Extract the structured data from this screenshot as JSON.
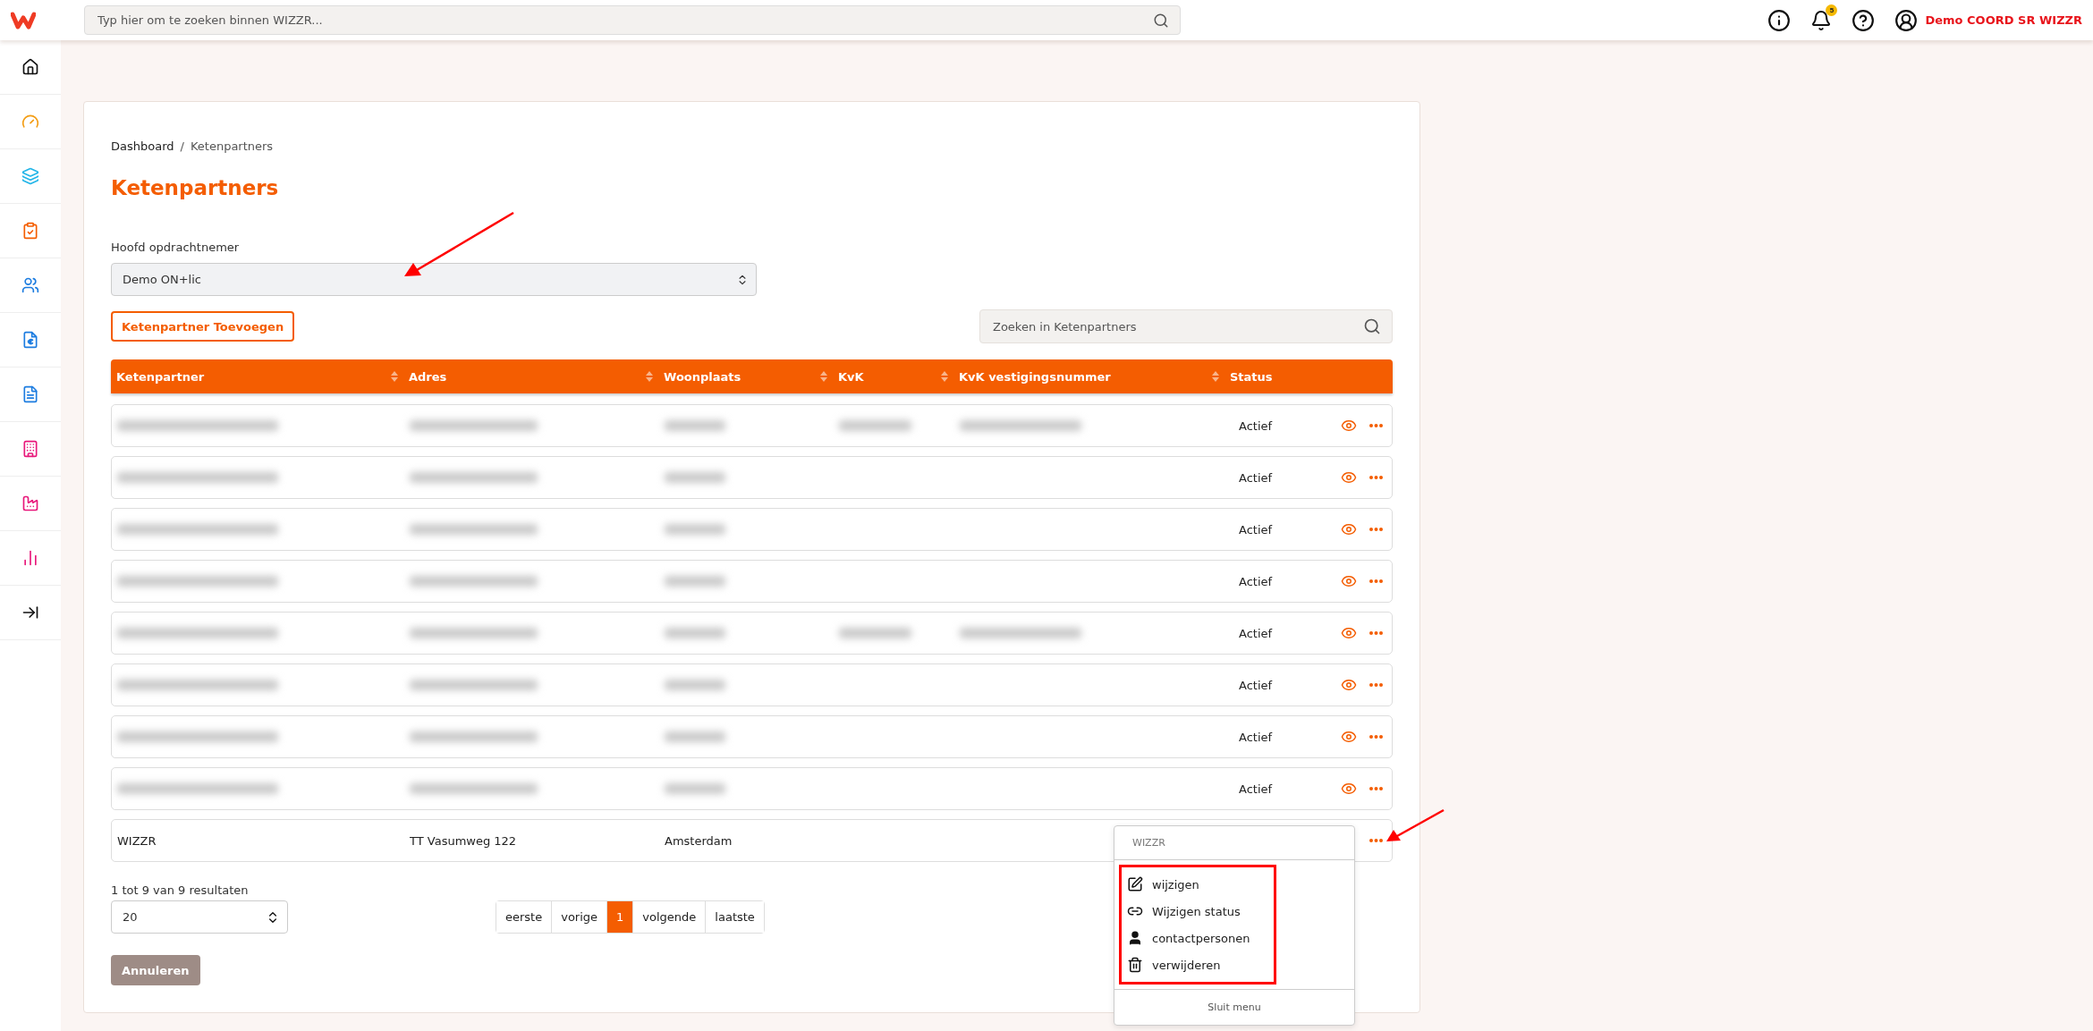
{
  "search": {
    "placeholder": "Typ hier om te zoeken binnen WIZZR..."
  },
  "notifications": {
    "count": "5"
  },
  "user": {
    "name": "Demo COORD SR WIZZR"
  },
  "breadcrumb": {
    "items": [
      "Dashboard",
      "Ketenpartners"
    ],
    "separator": "/"
  },
  "title": "Ketenpartners",
  "contractor_select": {
    "label": "Hoofd opdrachtnemer",
    "value": "Demo ON+lic"
  },
  "add_button": "Ketenpartner Toevoegen",
  "table_search": {
    "placeholder": "Zoeken in Ketenpartners"
  },
  "table": {
    "columns": [
      {
        "label": "Ketenpartner",
        "sortable": true
      },
      {
        "label": "Adres",
        "sortable": true
      },
      {
        "label": "Woonplaats",
        "sortable": true
      },
      {
        "label": "KvK",
        "sortable": true
      },
      {
        "label": "KvK vestigingsnummer",
        "sortable": true
      },
      {
        "label": "Status",
        "sortable": false
      }
    ],
    "rows": [
      {
        "kind": "blurred",
        "blurred": [
          true,
          true,
          true,
          true,
          true
        ],
        "status": "Actief"
      },
      {
        "kind": "blurred",
        "blurred": [
          true,
          true,
          true,
          false,
          false
        ],
        "status": "Actief"
      },
      {
        "kind": "blurred",
        "blurred": [
          true,
          true,
          true,
          false,
          false
        ],
        "status": "Actief"
      },
      {
        "kind": "blurred",
        "blurred": [
          true,
          true,
          true,
          false,
          false
        ],
        "status": "Actief"
      },
      {
        "kind": "blurred",
        "blurred": [
          true,
          true,
          true,
          true,
          true
        ],
        "status": "Actief"
      },
      {
        "kind": "blurred",
        "blurred": [
          true,
          true,
          true,
          false,
          false
        ],
        "status": "Actief"
      },
      {
        "kind": "blurred",
        "blurred": [
          true,
          true,
          true,
          false,
          false
        ],
        "status": "Actief"
      },
      {
        "kind": "blurred",
        "blurred": [
          true,
          true,
          true,
          false,
          false
        ],
        "status": "Actief"
      },
      {
        "kind": "plain",
        "cells": [
          "WIZZR",
          "TT Vasumweg 122",
          "Amsterdam"
        ],
        "menu_open": true
      }
    ]
  },
  "row_menu": {
    "title": "WIZZR",
    "items": [
      {
        "kind": "edit",
        "label": "wijzigen"
      },
      {
        "kind": "link",
        "label": "Wijzigen status"
      },
      {
        "kind": "person",
        "label": "contactpersonen"
      },
      {
        "kind": "trash",
        "label": "verwijderen"
      }
    ],
    "close": "Sluit menu"
  },
  "results_text": "1 tot 9 van 9 resultaten",
  "page_size": "20",
  "pagination": [
    {
      "label": "eerste",
      "selected": false
    },
    {
      "label": "vorige",
      "selected": false
    },
    {
      "label": "1",
      "selected": true
    },
    {
      "label": "volgende",
      "selected": false
    },
    {
      "label": "laatste",
      "selected": false
    }
  ],
  "cancel_button": {
    "label": "Annuleren",
    "disabled": true
  }
}
